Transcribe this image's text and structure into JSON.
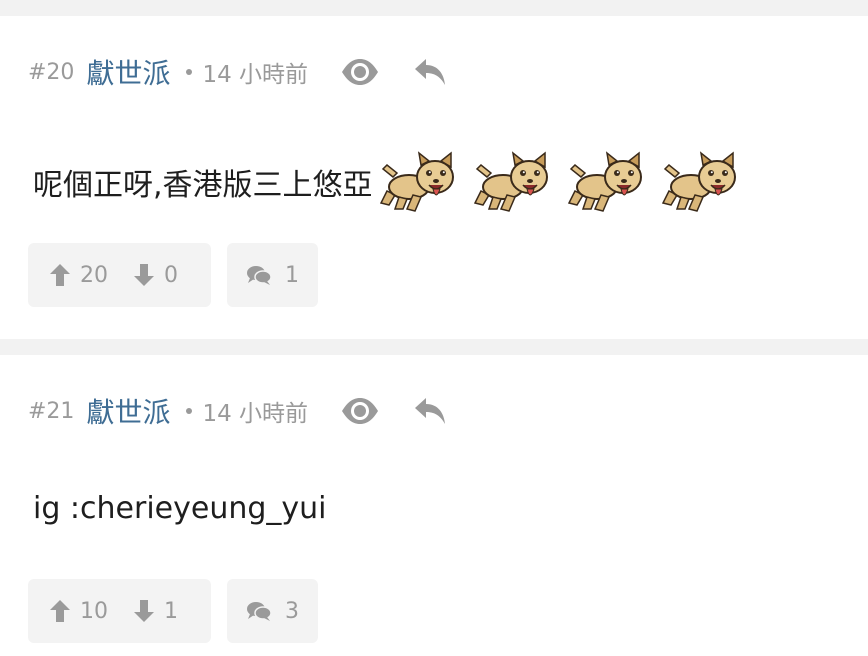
{
  "posts": [
    {
      "floor": "#20",
      "author": "獻世派",
      "time": "14 小時前",
      "text": "呢個正呀,香港版三上悠亞",
      "emoji_icons": [
        "dog-emoji",
        "dog-emoji",
        "dog-emoji",
        "dog-emoji"
      ],
      "upvotes": "20",
      "downvotes": "0",
      "comments": "1"
    },
    {
      "floor": "#21",
      "author": "獻世派",
      "time": "14 小時前",
      "text": "ig :cherieyeung_yui",
      "upvotes": "10",
      "downvotes": "1",
      "comments": "3"
    }
  ],
  "icons": {
    "view": "eye-icon",
    "reply": "reply-icon",
    "upvote": "arrow-up-icon",
    "downvote": "arrow-down-icon",
    "comment": "comment-bubbles-icon"
  },
  "colors": {
    "author": "#3f6d94",
    "muted": "#9a9a9a",
    "text": "#1e1e1e",
    "background": "#f2f2f2",
    "card": "#ffffff",
    "button_bg": "#f3f3f3"
  }
}
